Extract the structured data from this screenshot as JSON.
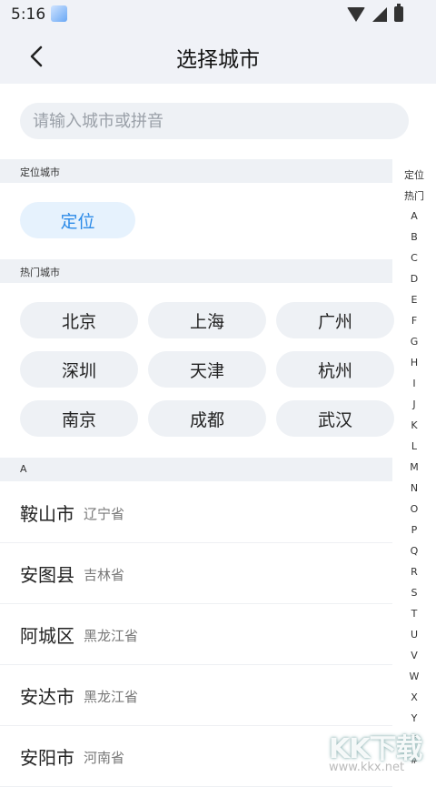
{
  "status": {
    "time": "5:16",
    "app_icon": "app-notification-icon",
    "wifi_icon": "wifi-icon",
    "signal_icon": "cell-signal-icon",
    "battery_icon": "battery-icon"
  },
  "header": {
    "title": "选择城市",
    "back_icon": "back-arrow-icon"
  },
  "search": {
    "placeholder": "请输入城市或拼音"
  },
  "located": {
    "section_label": "定位城市",
    "button_label": "定位"
  },
  "hot": {
    "section_label": "热门城市",
    "cities": [
      "北京",
      "上海",
      "广州",
      "深圳",
      "天津",
      "杭州",
      "南京",
      "成都",
      "武汉"
    ]
  },
  "groups": [
    {
      "letter": "A",
      "cities": [
        {
          "name": "鞍山市",
          "province": "辽宁省"
        },
        {
          "name": "安图县",
          "province": "吉林省"
        },
        {
          "name": "阿城区",
          "province": "黑龙江省"
        },
        {
          "name": "安达市",
          "province": "黑龙江省"
        },
        {
          "name": "安阳市",
          "province": "河南省"
        }
      ]
    }
  ],
  "index": [
    "定位",
    "热门",
    "A",
    "B",
    "C",
    "D",
    "E",
    "F",
    "G",
    "H",
    "I",
    "J",
    "K",
    "L",
    "M",
    "N",
    "O",
    "P",
    "Q",
    "R",
    "S",
    "T",
    "U",
    "V",
    "W",
    "X",
    "Y",
    "Z",
    "#"
  ],
  "watermark": {
    "brand": "KK下载",
    "url": "www.kkx.net"
  },
  "colors": {
    "accent": "#2c8be8",
    "chip_bg": "#eef1f5",
    "locate_bg": "#e6f2fd",
    "header_bg": "#f0f2f7"
  }
}
